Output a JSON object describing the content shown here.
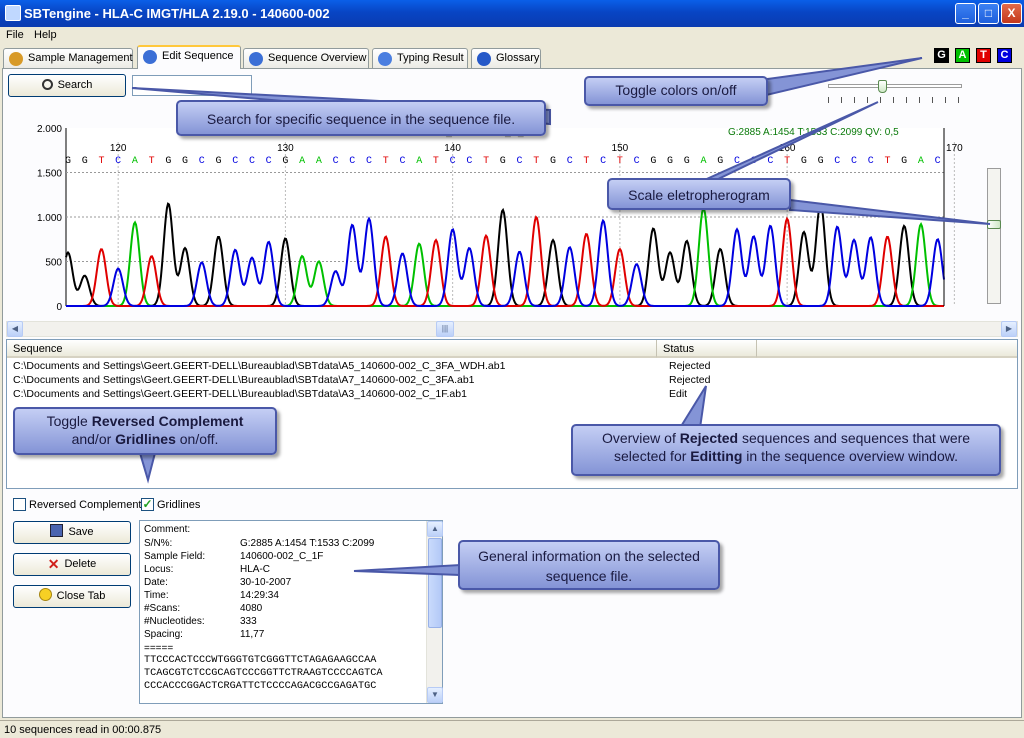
{
  "window": {
    "title": "SBTengine - HLA-C IMGT/HLA 2.19.0 - 140600-002",
    "min": "_",
    "max": "□",
    "close": "X"
  },
  "menu": [
    "File",
    "Help"
  ],
  "tabs": [
    {
      "label": "Sample Management",
      "color": "#d89a28"
    },
    {
      "label": "Edit Sequence",
      "color": "#3b6fd6"
    },
    {
      "label": "Sequence Overview",
      "color": "#3b6fd6"
    },
    {
      "label": "Typing Result",
      "color": "#4a7ee0"
    },
    {
      "label": "Glossary",
      "color": "#2659c8"
    }
  ],
  "search": {
    "label": "Search",
    "value": ""
  },
  "bases": [
    {
      "letter": "G",
      "color": "#000000"
    },
    {
      "letter": "A",
      "color": "#00c000"
    },
    {
      "letter": "T",
      "color": "#e00000"
    },
    {
      "letter": "C",
      "color": "#0000e0"
    }
  ],
  "chart_data": {
    "type": "line",
    "title": "",
    "file_label": "A3_140600-002_C_1F",
    "stats": "G:2885 A:1454 T:1533 C:2099 QV: 0,5",
    "ylim": [
      0,
      2000
    ],
    "yticks": [
      "2.000",
      "1.500",
      "1.000",
      "500",
      "0"
    ],
    "xticks": [
      {
        "label": "120",
        "pos": 120
      },
      {
        "label": "130",
        "pos": 130
      },
      {
        "label": "140",
        "pos": 140
      },
      {
        "label": "150",
        "pos": 150
      },
      {
        "label": "160",
        "pos": 160
      },
      {
        "label": "170",
        "pos": 170
      }
    ],
    "sequence": "GGTCATGGCGCCCGAACCCTCATCCTGCTGCTCTCGGGAGCCCTGGCCCTGAC",
    "seq_start": 117,
    "peak_heights": [
      600,
      340,
      640,
      420,
      940,
      560,
      1150,
      650,
      490,
      780,
      630,
      540,
      720,
      760,
      560,
      500,
      390,
      910,
      980,
      780,
      590,
      700,
      740,
      860,
      650,
      790,
      1080,
      610,
      1000,
      740,
      660,
      810,
      960,
      640,
      470,
      870,
      600,
      730,
      1100,
      640,
      860,
      780,
      900,
      980,
      830,
      1150,
      890,
      740,
      770,
      780,
      900,
      920,
      750
    ],
    "colors": {
      "G": "#000000",
      "A": "#00c000",
      "T": "#e00000",
      "C": "#0000e0"
    }
  },
  "callouts": {
    "toggle_colors": "Toggle colors on/off",
    "search": "Search for specific sequence in the sequence file.",
    "scale": "Scale eletropherogram",
    "toggle_rc_1": "Toggle",
    "toggle_rc_b1": "Reversed Complement",
    "toggle_rc_2": "and/or",
    "toggle_rc_b2": "Gridlines",
    "toggle_rc_3": "on/off.",
    "overview_1": "Overview of",
    "overview_b1": "Rejected",
    "overview_2": "sequences and sequences that were selected for",
    "overview_b2": "Editting",
    "overview_3": "in the sequence overview window.",
    "general": "General information on the selected sequence file."
  },
  "list": {
    "headers": [
      "Sequence",
      "Status"
    ],
    "rows": [
      {
        "path": "C:\\Documents and Settings\\Geert.GEERT-DELL\\Bureaublad\\SBTdata\\A5_140600-002_C_3FA_WDH.ab1",
        "status": "Rejected"
      },
      {
        "path": "C:\\Documents and Settings\\Geert.GEERT-DELL\\Bureaublad\\SBTdata\\A7_140600-002_C_3FA.ab1",
        "status": "Rejected"
      },
      {
        "path": "C:\\Documents and Settings\\Geert.GEERT-DELL\\Bureaublad\\SBTdata\\A3_140600-002_C_1F.ab1",
        "status": "Edit"
      }
    ]
  },
  "options": {
    "reversed": "Reversed Complement",
    "reversed_checked": false,
    "gridlines": "Gridlines",
    "gridlines_checked": true
  },
  "actions": {
    "save": "Save",
    "delete": "Delete",
    "close": "Close Tab"
  },
  "info": {
    "fields": [
      {
        "k": "Comment:",
        "v": ""
      },
      {
        "k": "S/N%:",
        "v": "G:2885 A:1454 T:1533 C:2099"
      },
      {
        "k": "Sample Field:",
        "v": "140600-002_C_1F"
      },
      {
        "k": "Locus:",
        "v": "HLA-C"
      },
      {
        "k": "Date:",
        "v": "30-10-2007"
      },
      {
        "k": "Time:",
        "v": "14:29:34"
      },
      {
        "k": "#Scans:",
        "v": "4080"
      },
      {
        "k": "#Nucleotides:",
        "v": "333"
      },
      {
        "k": "Spacing:",
        "v": "11,77"
      }
    ],
    "separator": "=====",
    "seq_lines": [
      "TTCCCACTCCCWTGGGTGTCGGGTTCTAGAGAAGCCAA",
      "TCAGCGTCTCCGCAGTCCCGGTTCTRAAGTCCCCAGTCA",
      "CCCACCCGGACTCRGATTCTCCCCAGACGCCGAGATGC"
    ]
  },
  "status_bar": "10 sequences read in 00:00.875"
}
